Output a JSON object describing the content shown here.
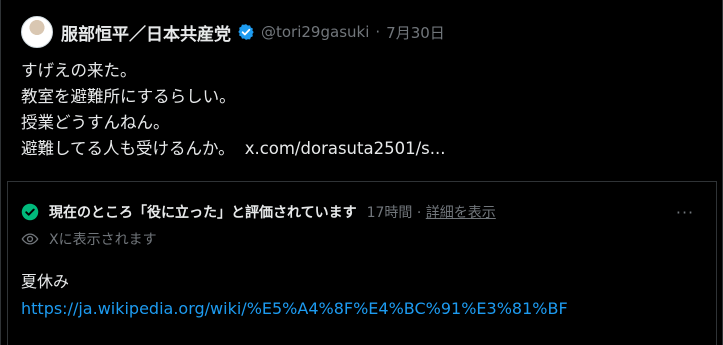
{
  "author": {
    "display_name": "服部恒平／日本共産党",
    "handle": "@tori29gasuki",
    "separator": "·",
    "date": "7月30日"
  },
  "tweet": {
    "lines": [
      "すげえの来た。",
      "教室を避難所にするらしい。",
      "授業どうすんねん。",
      "避難してる人も受けるんか。"
    ],
    "link_text": "x.com/dorasuta2501/s..."
  },
  "community_note": {
    "status": "現在のところ「役に立った」と評価されています",
    "age": "17時間",
    "separator": "·",
    "detail_link": "詳細を表示",
    "more_label": "···",
    "visibility": "Xに表示されます",
    "body_title": "夏休み",
    "body_url": "https://ja.wikipedia.org/wiki/%E5%A4%8F%E4%BC%91%E3%81%BF"
  },
  "colors": {
    "background": "#000000",
    "text": "#e7e9ea",
    "muted": "#71767b",
    "link": "#1d9bf0",
    "verified": "#1d9bf0",
    "success": "#00ba7c"
  },
  "icons": {
    "verified": "verified-badge-icon",
    "check": "check-circle-icon",
    "visibility": "eye-icon",
    "more": "more-horizontal-icon"
  }
}
